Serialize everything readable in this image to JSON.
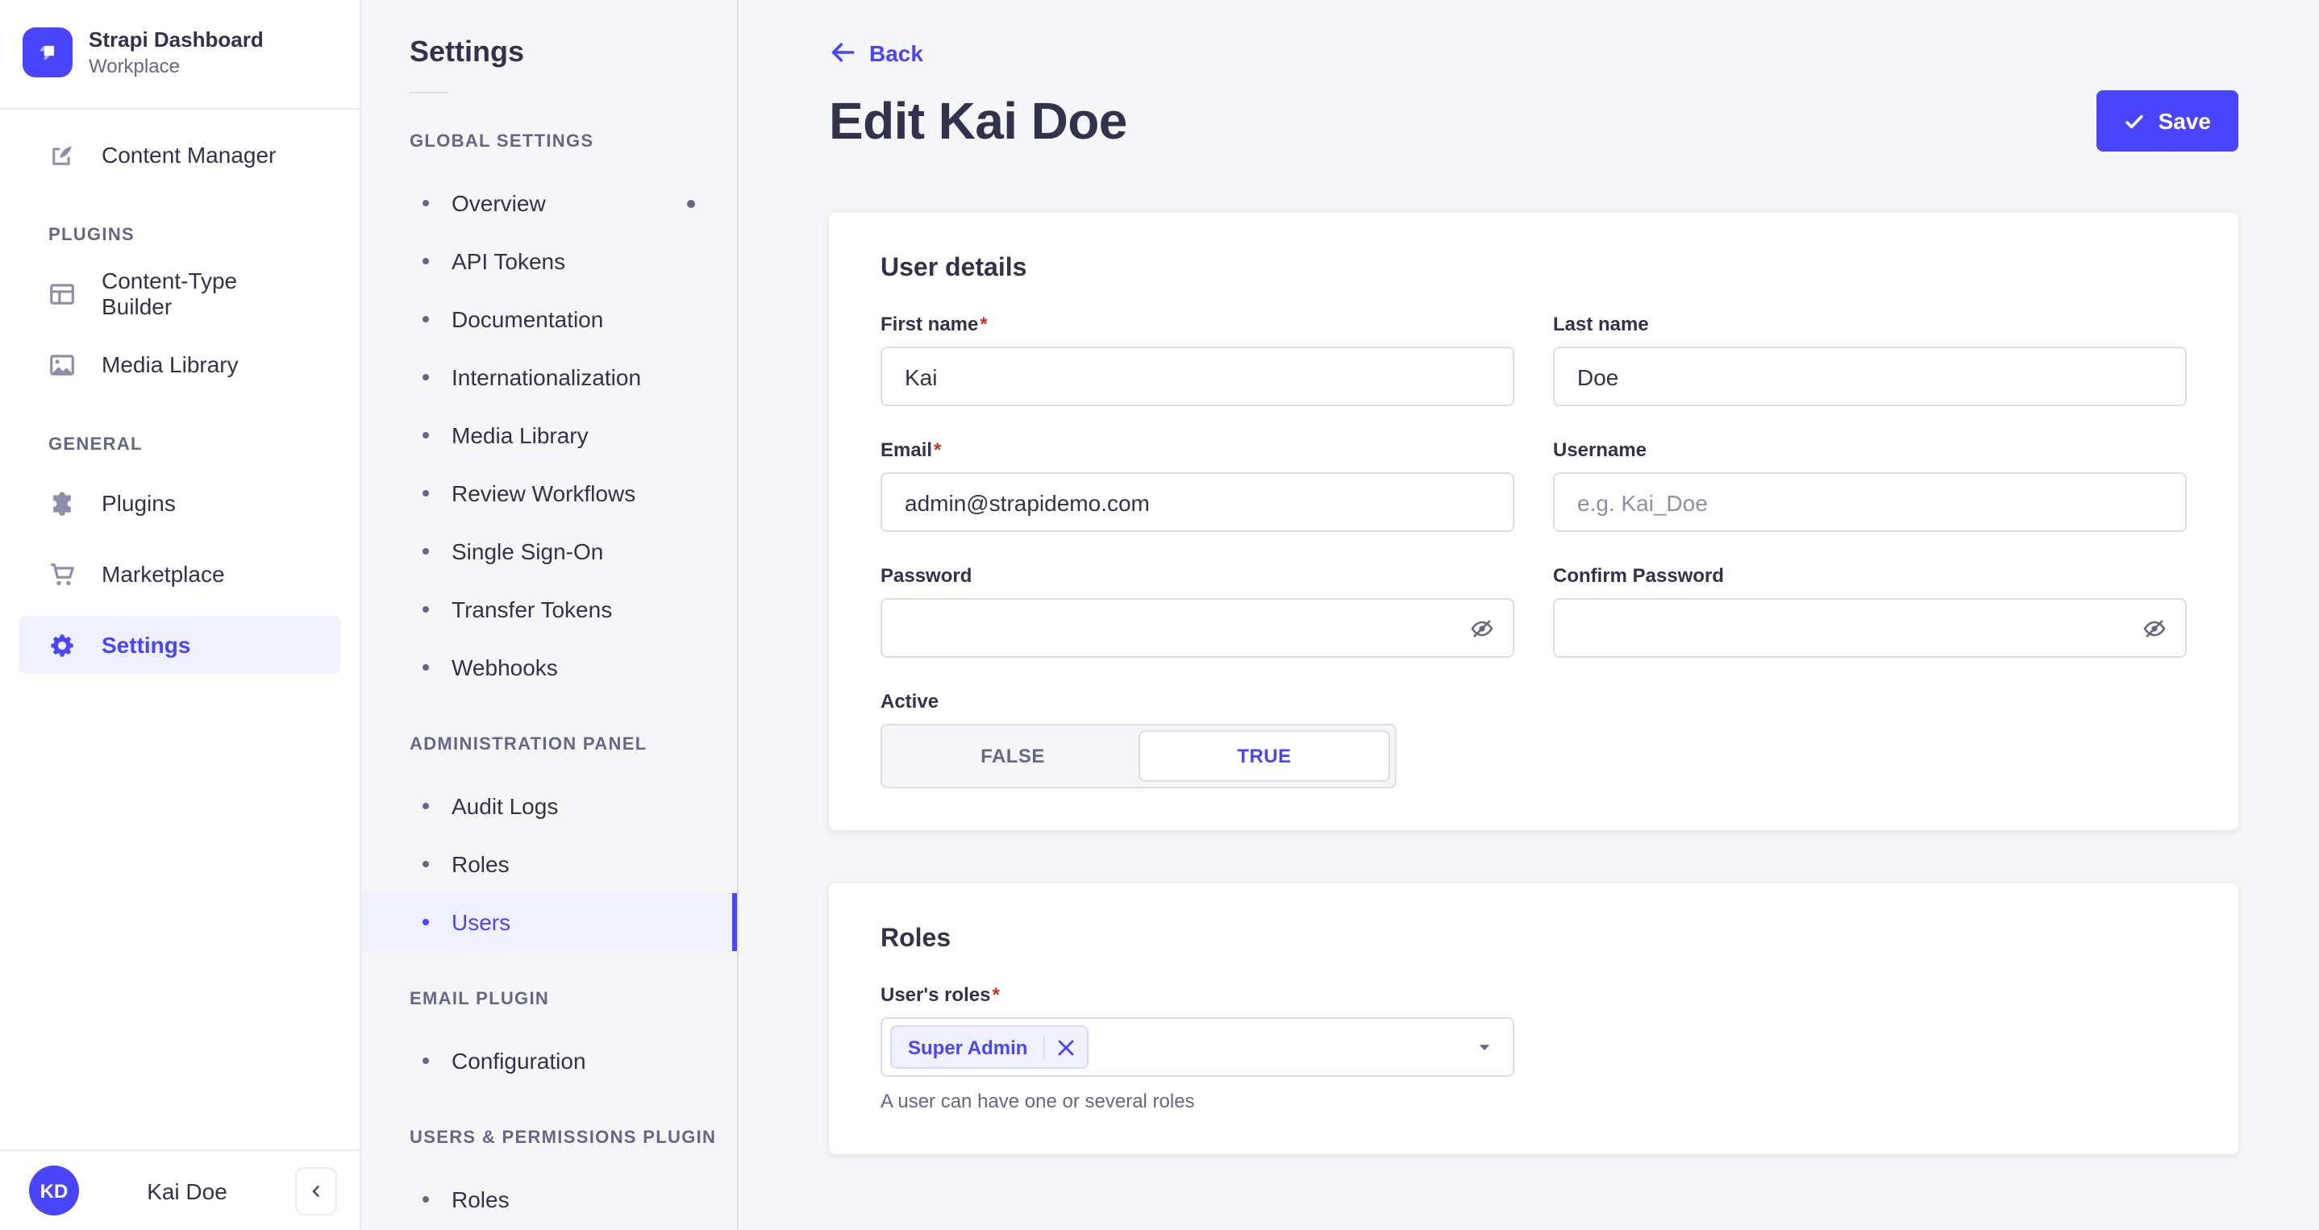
{
  "colors": {
    "accent": "#4945FF",
    "accent_bg": "#F0F0FF",
    "danger": "#D02B20",
    "text": "#32324D",
    "text_muted": "#666687",
    "background": "#F6F6F9",
    "input_border": "#DCDCE4"
  },
  "required_mark": "*",
  "brand": {
    "name": "Strapi Dashboard",
    "workspace": "Workplace"
  },
  "main_nav": {
    "content_manager": "Content Manager",
    "sections": [
      {
        "title": "PLUGINS",
        "items": [
          {
            "label": "Content-Type Builder",
            "icon": "layout-grid-icon"
          },
          {
            "label": "Media Library",
            "icon": "image-icon"
          }
        ]
      },
      {
        "title": "GENERAL",
        "items": [
          {
            "label": "Plugins",
            "icon": "puzzle-icon"
          },
          {
            "label": "Marketplace",
            "icon": "cart-icon"
          },
          {
            "label": "Settings",
            "icon": "gear-icon"
          }
        ]
      }
    ],
    "user": {
      "initials": "KD",
      "name": "Kai Doe"
    }
  },
  "settings_nav": {
    "title": "Settings",
    "groups": [
      {
        "title": "GLOBAL SETTINGS",
        "items": [
          "Overview",
          "API Tokens",
          "Documentation",
          "Internationalization",
          "Media Library",
          "Review Workflows",
          "Single Sign-On",
          "Transfer Tokens",
          "Webhooks"
        ]
      },
      {
        "title": "ADMINISTRATION PANEL",
        "items": [
          "Audit Logs",
          "Roles",
          "Users"
        ]
      },
      {
        "title": "EMAIL PLUGIN",
        "items": [
          "Configuration"
        ]
      },
      {
        "title": "USERS & PERMISSIONS PLUGIN",
        "items": [
          "Roles"
        ]
      }
    ],
    "active_item": "Users"
  },
  "header": {
    "back_label": "Back",
    "title": "Edit Kai Doe",
    "save_label": "Save"
  },
  "user_details": {
    "title": "User details",
    "fields": {
      "first_name": {
        "label": "First name",
        "required": true,
        "value": "Kai"
      },
      "last_name": {
        "label": "Last name",
        "value": "Doe"
      },
      "email": {
        "label": "Email",
        "required": true,
        "value": "admin@strapidemo.com"
      },
      "username": {
        "label": "Username",
        "placeholder": "e.g. Kai_Doe"
      },
      "password": {
        "label": "Password"
      },
      "confirm_password": {
        "label": "Confirm Password"
      },
      "active": {
        "label": "Active",
        "options": [
          "FALSE",
          "TRUE"
        ],
        "value": "TRUE"
      }
    }
  },
  "roles_card": {
    "title": "Roles",
    "field_label": "User's roles",
    "required": true,
    "selected_roles": [
      "Super Admin"
    ],
    "helper": "A user can have one or several roles"
  }
}
